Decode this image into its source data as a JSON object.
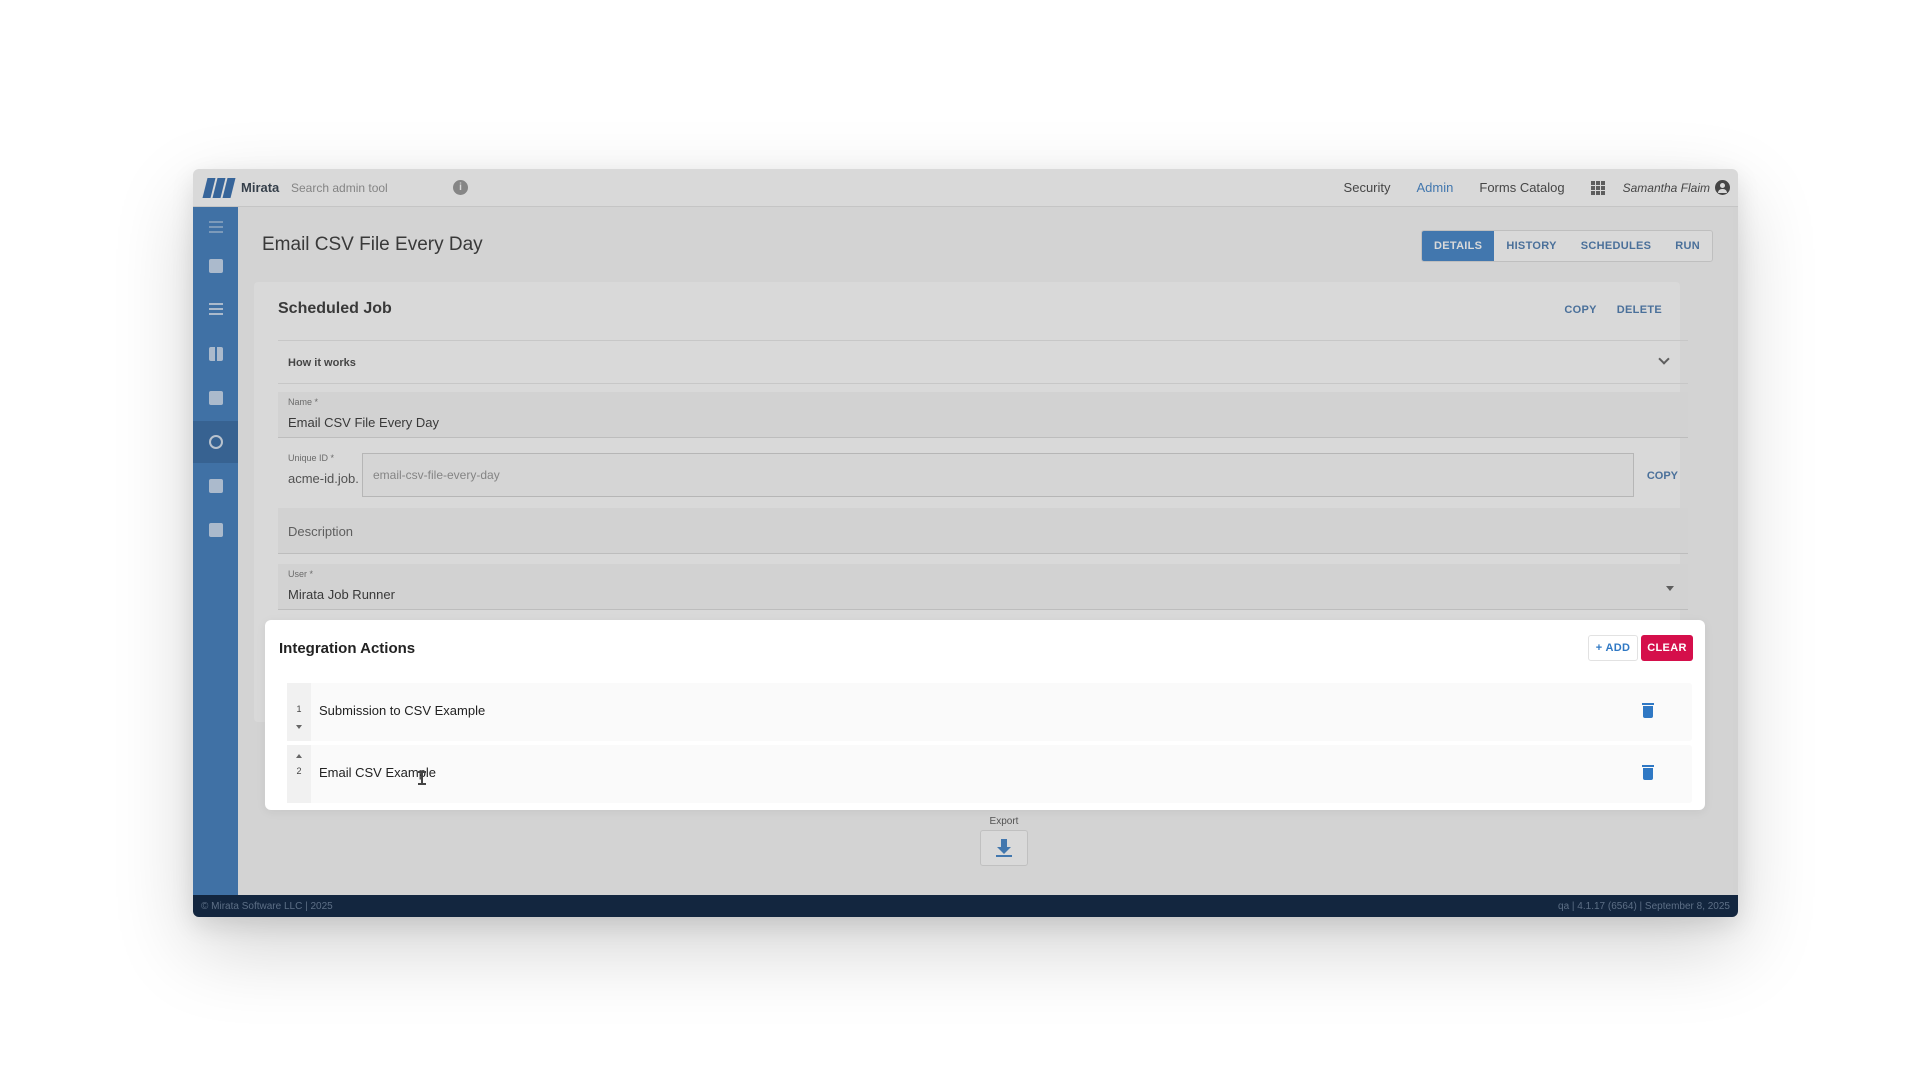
{
  "app": {
    "brand": "Mirata",
    "search_placeholder": "Search admin tool",
    "info_icon": "info-icon",
    "nav": [
      "Security",
      "Admin",
      "Forms Catalog"
    ],
    "active_nav": "Admin",
    "user_name": "Samantha Flaim"
  },
  "sidebar": {
    "items": [
      "reports-icon",
      "list-icon",
      "sliders-icon",
      "dashboard-icon",
      "clock-icon",
      "document-icon",
      "link-icon"
    ],
    "active_item": "clock-icon"
  },
  "page": {
    "title": "Email CSV File Every Day",
    "tabs": [
      "DETAILS",
      "HISTORY",
      "SCHEDULES",
      "RUN"
    ],
    "active_tab": "DETAILS"
  },
  "card": {
    "title": "Scheduled Job",
    "actions": [
      "COPY",
      "DELETE"
    ],
    "how_it_works": "How it works",
    "fields": {
      "name": {
        "label": "Name *",
        "value": "Email CSV File Every Day"
      },
      "unique_id": {
        "label": "Unique ID *",
        "prefix": "acme-id.job.",
        "value": "email-csv-file-every-day",
        "copy_label": "COPY"
      },
      "description": {
        "placeholder": "Description"
      },
      "user": {
        "label": "User *",
        "value": "Mirata Job Runner"
      }
    }
  },
  "integration_actions": {
    "title": "Integration Actions",
    "add_label": "+ ADD",
    "clear_label": "CLEAR",
    "items": [
      {
        "order": "1",
        "label": "Submission to CSV Example"
      },
      {
        "order": "2",
        "label": "Email CSV Example"
      }
    ]
  },
  "export": {
    "label": "Export"
  },
  "footer": {
    "left": "© Mirata Software LLC | 2025",
    "right": "qa | 4.1.17 (6564) | September 8, 2025"
  },
  "colors": {
    "primary": "#2f78c4",
    "sidebar": "#2c6fb8",
    "danger": "#d50f4b",
    "footer": "#13263f"
  }
}
